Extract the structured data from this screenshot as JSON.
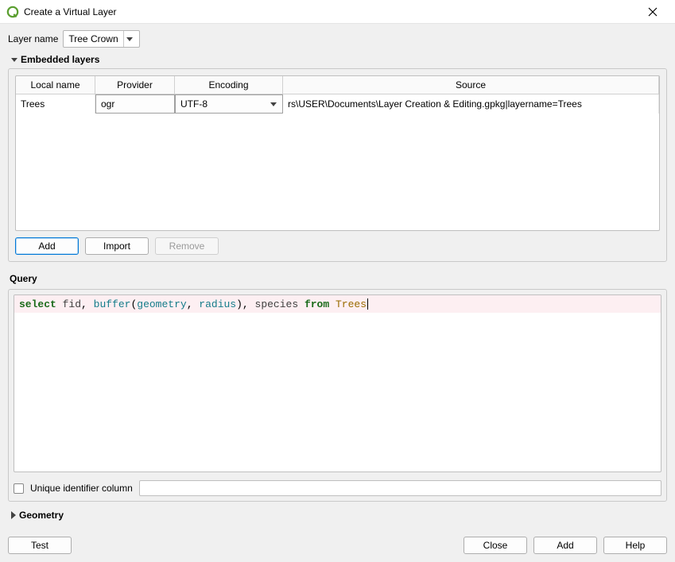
{
  "window": {
    "title": "Create a Virtual Layer"
  },
  "layerName": {
    "label": "Layer name",
    "value": "Tree Crown"
  },
  "sections": {
    "embedded": "Embedded layers",
    "geometry": "Geometry"
  },
  "embeddedTable": {
    "headers": {
      "localName": "Local name",
      "provider": "Provider",
      "encoding": "Encoding",
      "source": "Source"
    },
    "rows": [
      {
        "localName": "Trees",
        "provider": "ogr",
        "encoding": "UTF-8",
        "source": "rs\\USER\\Documents\\Layer Creation & Editing.gpkg|layername=Trees"
      }
    ]
  },
  "embeddedButtons": {
    "add": "Add",
    "import": "Import",
    "remove": "Remove"
  },
  "query": {
    "label": "Query",
    "tokens": {
      "select": "select",
      "fid": "fid",
      "buffer": "buffer",
      "geometry": "geometry",
      "radius": "radius",
      "species": "species",
      "from": "from",
      "trees": "Trees"
    }
  },
  "uid": {
    "label": "Unique identifier column",
    "checked": false
  },
  "bottomButtons": {
    "test": "Test",
    "close": "Close",
    "add": "Add",
    "help": "Help"
  }
}
